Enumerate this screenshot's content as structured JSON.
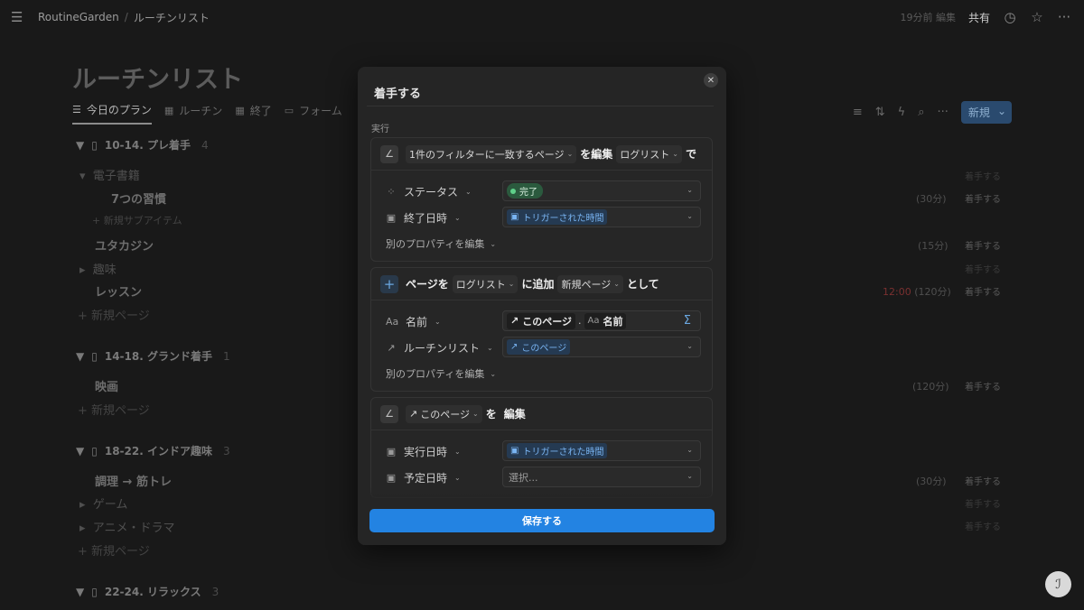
{
  "topbar": {
    "workspace": "RoutineGarden",
    "page": "ルーチンリスト",
    "edited": "19分前 編集",
    "share": "共有"
  },
  "page": {
    "title": "ルーチンリスト",
    "views": [
      "今日のプラン",
      "ルーチン",
      "終了",
      "フォーム"
    ],
    "new_button": "新規"
  },
  "groups": [
    {
      "name": "10-14. プレ着手",
      "count": "4"
    },
    {
      "name": "14-18. グランド着手",
      "count": "1"
    },
    {
      "name": "18-22. インドア趣味",
      "count": "3"
    },
    {
      "name": "22-24. リラックス",
      "count": "3"
    }
  ],
  "rows": {
    "r1": "電子書籍",
    "r2": "7つの習慣",
    "r3": "新規サブアイテム",
    "r4": "ユタカジン",
    "r5": "趣味",
    "r6": "レッスン",
    "r7": "新規ページ",
    "r8": "映画",
    "r9": "新規ページ",
    "r10": "調理 → 筋トレ",
    "r11": "ゲーム",
    "r12": "アニメ・ドラマ",
    "r13": "新規ページ"
  },
  "meta": {
    "m1": "(30分)",
    "m2": "(15分)",
    "m3_time": "12:00",
    "m3": "(120分)",
    "m4": "(120分)",
    "m5": "(30分)"
  },
  "start_label": "着手する",
  "modal": {
    "title": "着手する",
    "section": "実行",
    "card1": {
      "target": "1件のフィルターに一致するページ",
      "verb1": "を編集",
      "db": "ログリスト",
      "verb2": "で",
      "prop1_name": "ステータス",
      "prop1_value": "完了",
      "prop2_name": "終了日時",
      "prop2_value": "トリガーされた時間",
      "edit_other": "別のプロパティを編集"
    },
    "card2": {
      "lead": "ページを",
      "db": "ログリスト",
      "verb": "に追加",
      "mode": "新規ページ",
      "tail": "として",
      "prop1_name": "名前",
      "prop1_chip1": "このページ",
      "prop1_chip2": "名前",
      "prop2_name": "ルーチンリスト",
      "prop2_value": "このページ",
      "edit_other": "別のプロパティを編集"
    },
    "card3": {
      "target": "このページ",
      "particle": "を",
      "verb": "編集",
      "prop1_name": "実行日時",
      "prop1_value": "トリガーされた時間",
      "prop2_name": "予定日時",
      "prop2_value": "選択..."
    },
    "save": "保存する"
  }
}
